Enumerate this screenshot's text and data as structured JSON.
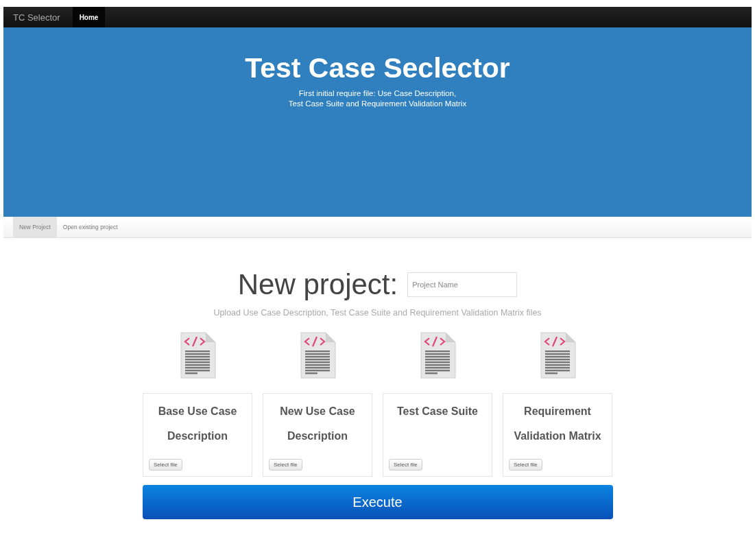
{
  "navbar": {
    "brand": "TC Selector",
    "items": [
      {
        "label": "Home",
        "selected": true
      }
    ]
  },
  "hero": {
    "title": "Test Case Seclector",
    "subtitle_lines": [
      "First initial require file: Use Case Description,",
      "Test Case Suite and Requirement Validation Matrix"
    ]
  },
  "tabs": [
    {
      "label": "New Project",
      "selected": true
    },
    {
      "label": "Open existing project",
      "selected": false
    }
  ],
  "new_project": {
    "heading": "New project:",
    "name_field": {
      "placeholder": "Project Name"
    },
    "instructions": "Upload Use Case Description, Test Case Suite and Requirement Validation Matrix files",
    "files": [
      {
        "title": "Base Use Case Description",
        "button": "Select file"
      },
      {
        "title": "New Use Case Description",
        "button": "Select file"
      },
      {
        "title": "Test Case Suite",
        "button": "Select file"
      },
      {
        "title": "Requirement Validation Matrix",
        "button": "Select file"
      }
    ],
    "execute_button": "Execute"
  }
}
